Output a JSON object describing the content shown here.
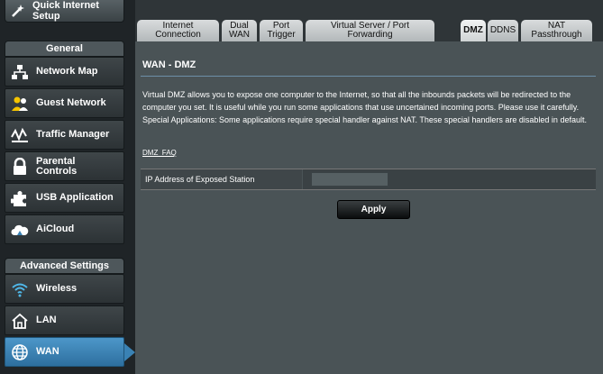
{
  "sidebar": {
    "quick_setup": "Quick Internet Setup",
    "general_header": "General",
    "general_items": [
      {
        "label": "Network Map",
        "icon": "network-map-icon"
      },
      {
        "label": "Guest Network",
        "icon": "guest-network-icon"
      },
      {
        "label": "Traffic Manager",
        "icon": "traffic-manager-icon"
      },
      {
        "label": "Parental Controls",
        "icon": "lock-icon"
      },
      {
        "label": "USB Application",
        "icon": "puzzle-icon"
      },
      {
        "label": "AiCloud",
        "icon": "cloud-icon"
      }
    ],
    "advanced_header": "Advanced Settings",
    "advanced_items": [
      {
        "label": "Wireless",
        "icon": "wifi-icon"
      },
      {
        "label": "LAN",
        "icon": "home-icon"
      },
      {
        "label": "WAN",
        "icon": "globe-icon",
        "active": true
      }
    ]
  },
  "tabs": [
    {
      "line1": "Internet",
      "line2": "Connection"
    },
    {
      "line1": "Dual",
      "line2": "WAN"
    },
    {
      "line1": "Port",
      "line2": "Trigger"
    },
    {
      "line1": "Virtual Server / Port",
      "line2": "Forwarding"
    },
    {
      "line1": "DMZ",
      "line2": "",
      "active": true
    },
    {
      "line1": "DDNS",
      "line2": ""
    },
    {
      "line1": "NAT",
      "line2": "Passthrough"
    }
  ],
  "page": {
    "title": "WAN - DMZ",
    "description": "Virtual DMZ allows you to expose one computer to the Internet, so that all the inbounds packets will be redirected to the computer you set. It is useful while you run some applications that use uncertained incoming ports. Please use it carefully. Special Applications: Some applications require special handler against NAT. These special handlers are disabled in default.",
    "faq_link": "DMZ_FAQ",
    "ip_label": "IP Address of Exposed Station",
    "ip_value": "",
    "apply_label": "Apply"
  },
  "colors": {
    "accent": "#3a82b4",
    "background": "#4a5356"
  }
}
